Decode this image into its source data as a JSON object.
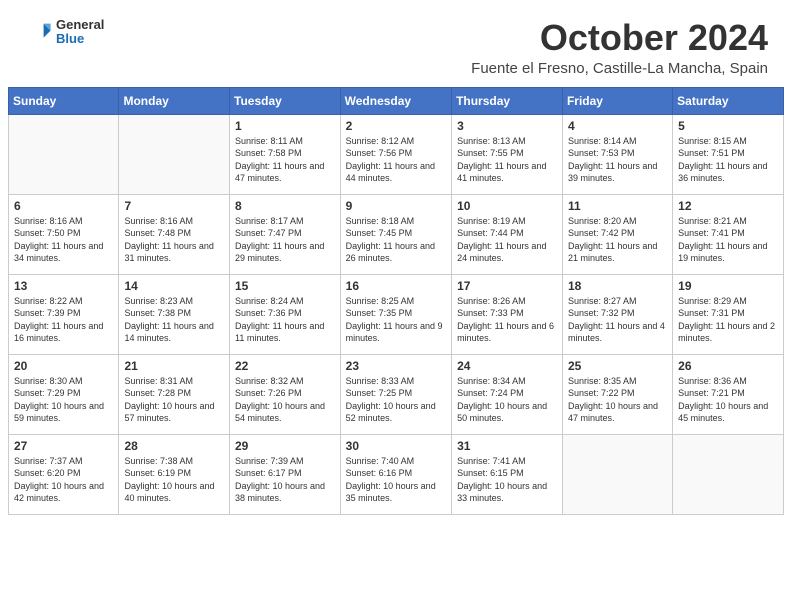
{
  "header": {
    "logo": {
      "general": "General",
      "blue": "Blue"
    },
    "title": "October 2024",
    "location": "Fuente el Fresno, Castille-La Mancha, Spain"
  },
  "weekdays": [
    "Sunday",
    "Monday",
    "Tuesday",
    "Wednesday",
    "Thursday",
    "Friday",
    "Saturday"
  ],
  "weeks": [
    [
      {
        "day": "",
        "sunrise": "",
        "sunset": "",
        "daylight": ""
      },
      {
        "day": "",
        "sunrise": "",
        "sunset": "",
        "daylight": ""
      },
      {
        "day": "1",
        "sunrise": "Sunrise: 8:11 AM",
        "sunset": "Sunset: 7:58 PM",
        "daylight": "Daylight: 11 hours and 47 minutes."
      },
      {
        "day": "2",
        "sunrise": "Sunrise: 8:12 AM",
        "sunset": "Sunset: 7:56 PM",
        "daylight": "Daylight: 11 hours and 44 minutes."
      },
      {
        "day": "3",
        "sunrise": "Sunrise: 8:13 AM",
        "sunset": "Sunset: 7:55 PM",
        "daylight": "Daylight: 11 hours and 41 minutes."
      },
      {
        "day": "4",
        "sunrise": "Sunrise: 8:14 AM",
        "sunset": "Sunset: 7:53 PM",
        "daylight": "Daylight: 11 hours and 39 minutes."
      },
      {
        "day": "5",
        "sunrise": "Sunrise: 8:15 AM",
        "sunset": "Sunset: 7:51 PM",
        "daylight": "Daylight: 11 hours and 36 minutes."
      }
    ],
    [
      {
        "day": "6",
        "sunrise": "Sunrise: 8:16 AM",
        "sunset": "Sunset: 7:50 PM",
        "daylight": "Daylight: 11 hours and 34 minutes."
      },
      {
        "day": "7",
        "sunrise": "Sunrise: 8:16 AM",
        "sunset": "Sunset: 7:48 PM",
        "daylight": "Daylight: 11 hours and 31 minutes."
      },
      {
        "day": "8",
        "sunrise": "Sunrise: 8:17 AM",
        "sunset": "Sunset: 7:47 PM",
        "daylight": "Daylight: 11 hours and 29 minutes."
      },
      {
        "day": "9",
        "sunrise": "Sunrise: 8:18 AM",
        "sunset": "Sunset: 7:45 PM",
        "daylight": "Daylight: 11 hours and 26 minutes."
      },
      {
        "day": "10",
        "sunrise": "Sunrise: 8:19 AM",
        "sunset": "Sunset: 7:44 PM",
        "daylight": "Daylight: 11 hours and 24 minutes."
      },
      {
        "day": "11",
        "sunrise": "Sunrise: 8:20 AM",
        "sunset": "Sunset: 7:42 PM",
        "daylight": "Daylight: 11 hours and 21 minutes."
      },
      {
        "day": "12",
        "sunrise": "Sunrise: 8:21 AM",
        "sunset": "Sunset: 7:41 PM",
        "daylight": "Daylight: 11 hours and 19 minutes."
      }
    ],
    [
      {
        "day": "13",
        "sunrise": "Sunrise: 8:22 AM",
        "sunset": "Sunset: 7:39 PM",
        "daylight": "Daylight: 11 hours and 16 minutes."
      },
      {
        "day": "14",
        "sunrise": "Sunrise: 8:23 AM",
        "sunset": "Sunset: 7:38 PM",
        "daylight": "Daylight: 11 hours and 14 minutes."
      },
      {
        "day": "15",
        "sunrise": "Sunrise: 8:24 AM",
        "sunset": "Sunset: 7:36 PM",
        "daylight": "Daylight: 11 hours and 11 minutes."
      },
      {
        "day": "16",
        "sunrise": "Sunrise: 8:25 AM",
        "sunset": "Sunset: 7:35 PM",
        "daylight": "Daylight: 11 hours and 9 minutes."
      },
      {
        "day": "17",
        "sunrise": "Sunrise: 8:26 AM",
        "sunset": "Sunset: 7:33 PM",
        "daylight": "Daylight: 11 hours and 6 minutes."
      },
      {
        "day": "18",
        "sunrise": "Sunrise: 8:27 AM",
        "sunset": "Sunset: 7:32 PM",
        "daylight": "Daylight: 11 hours and 4 minutes."
      },
      {
        "day": "19",
        "sunrise": "Sunrise: 8:29 AM",
        "sunset": "Sunset: 7:31 PM",
        "daylight": "Daylight: 11 hours and 2 minutes."
      }
    ],
    [
      {
        "day": "20",
        "sunrise": "Sunrise: 8:30 AM",
        "sunset": "Sunset: 7:29 PM",
        "daylight": "Daylight: 10 hours and 59 minutes."
      },
      {
        "day": "21",
        "sunrise": "Sunrise: 8:31 AM",
        "sunset": "Sunset: 7:28 PM",
        "daylight": "Daylight: 10 hours and 57 minutes."
      },
      {
        "day": "22",
        "sunrise": "Sunrise: 8:32 AM",
        "sunset": "Sunset: 7:26 PM",
        "daylight": "Daylight: 10 hours and 54 minutes."
      },
      {
        "day": "23",
        "sunrise": "Sunrise: 8:33 AM",
        "sunset": "Sunset: 7:25 PM",
        "daylight": "Daylight: 10 hours and 52 minutes."
      },
      {
        "day": "24",
        "sunrise": "Sunrise: 8:34 AM",
        "sunset": "Sunset: 7:24 PM",
        "daylight": "Daylight: 10 hours and 50 minutes."
      },
      {
        "day": "25",
        "sunrise": "Sunrise: 8:35 AM",
        "sunset": "Sunset: 7:22 PM",
        "daylight": "Daylight: 10 hours and 47 minutes."
      },
      {
        "day": "26",
        "sunrise": "Sunrise: 8:36 AM",
        "sunset": "Sunset: 7:21 PM",
        "daylight": "Daylight: 10 hours and 45 minutes."
      }
    ],
    [
      {
        "day": "27",
        "sunrise": "Sunrise: 7:37 AM",
        "sunset": "Sunset: 6:20 PM",
        "daylight": "Daylight: 10 hours and 42 minutes."
      },
      {
        "day": "28",
        "sunrise": "Sunrise: 7:38 AM",
        "sunset": "Sunset: 6:19 PM",
        "daylight": "Daylight: 10 hours and 40 minutes."
      },
      {
        "day": "29",
        "sunrise": "Sunrise: 7:39 AM",
        "sunset": "Sunset: 6:17 PM",
        "daylight": "Daylight: 10 hours and 38 minutes."
      },
      {
        "day": "30",
        "sunrise": "Sunrise: 7:40 AM",
        "sunset": "Sunset: 6:16 PM",
        "daylight": "Daylight: 10 hours and 35 minutes."
      },
      {
        "day": "31",
        "sunrise": "Sunrise: 7:41 AM",
        "sunset": "Sunset: 6:15 PM",
        "daylight": "Daylight: 10 hours and 33 minutes."
      },
      {
        "day": "",
        "sunrise": "",
        "sunset": "",
        "daylight": ""
      },
      {
        "day": "",
        "sunrise": "",
        "sunset": "",
        "daylight": ""
      }
    ]
  ]
}
